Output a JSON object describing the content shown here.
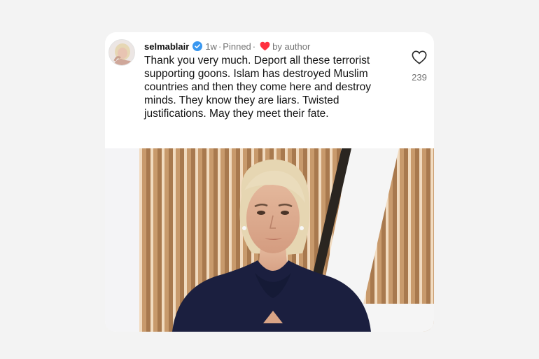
{
  "comment": {
    "username": "selmablair",
    "time": "1w",
    "separator": "·",
    "pinned": "Pinned",
    "by_author": "by author",
    "text": "Thank you very much. Deport all these terrorist supporting goons. Islam has destroyed Muslim countries and then they come here and destroy minds.  They know they are liars. Twisted justifications. May they meet their fate.",
    "likes": "239"
  },
  "colors": {
    "verified": "#3897f0",
    "heart_red": "#ff3040",
    "text": "#111111",
    "muted": "#737373"
  },
  "icons": {
    "verified": "verified-badge-icon",
    "author_heart": "heart-filled-icon",
    "like": "heart-outline-icon"
  }
}
